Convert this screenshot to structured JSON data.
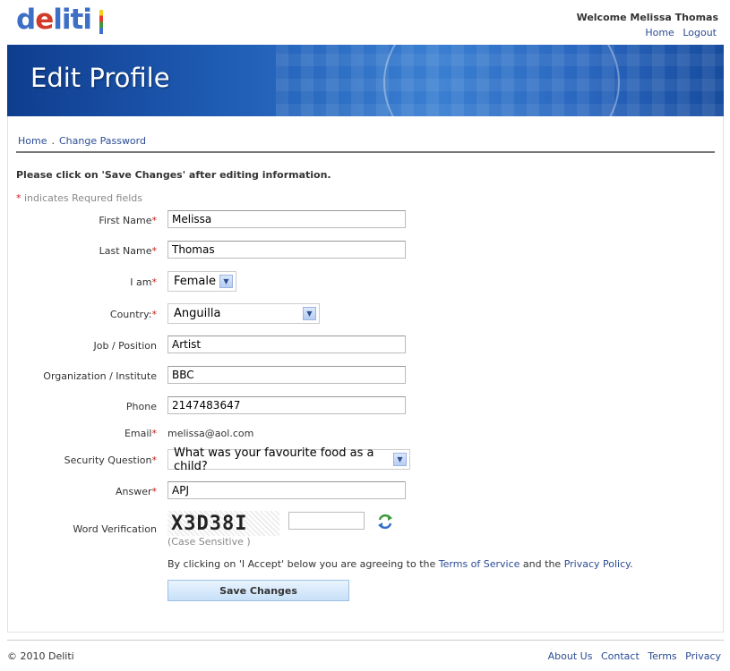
{
  "header": {
    "logo_letters": [
      "d",
      "e",
      "l",
      "i",
      "t",
      "i"
    ],
    "welcome": "Welcome Melissa Thomas",
    "links": [
      "Home",
      "Logout"
    ]
  },
  "banner": {
    "title": "Edit Profile"
  },
  "breadcrumb": {
    "items": [
      "Home",
      "Change Password"
    ],
    "separator": "."
  },
  "instruction": "Please click on 'Save Changes' after editing information.",
  "required_note": {
    "star": "*",
    "text": " indicates Requred fields"
  },
  "form": {
    "first_name": {
      "label": "First Name",
      "value": "Melissa"
    },
    "last_name": {
      "label": "Last Name",
      "value": "Thomas"
    },
    "gender": {
      "label": "I am",
      "value": "Female"
    },
    "country": {
      "label": "Country:",
      "value": "Anguilla"
    },
    "job": {
      "label": "Job / Position",
      "value": "Artist"
    },
    "organization": {
      "label": "Organization / Institute",
      "value": "BBC"
    },
    "phone": {
      "label": "Phone",
      "value": "2147483647"
    },
    "email": {
      "label": "Email",
      "value": "melissa@aol.com"
    },
    "security_question": {
      "label": "Security Question",
      "value": "What was your favourite food as a child?"
    },
    "answer": {
      "label": "Answer",
      "value": "APJ"
    },
    "word_verification": {
      "label": "Word Verification",
      "captcha_text": "X3D38I",
      "input_value": "",
      "case_note": "(Case Sensitive )"
    }
  },
  "agreement": {
    "prefix": "By clicking on 'I Accept' below you are agreeing to the ",
    "tos": "Terms of Service",
    "middle": " and the ",
    "privacy": "Privacy Policy",
    "suffix": "."
  },
  "save_button": "Save Changes",
  "footer": {
    "copyright": "© 2010 Deliti",
    "links": [
      "About Us",
      "Contact",
      "Terms",
      "Privacy"
    ]
  },
  "colors": {
    "link": "#2b4c95",
    "required_star": "#c2201e",
    "banner": "#1f5cb4"
  }
}
